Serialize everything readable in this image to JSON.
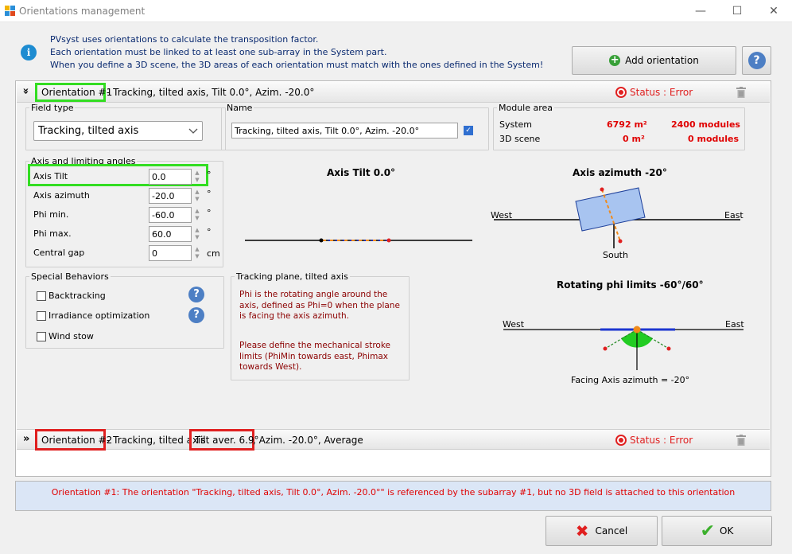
{
  "window": {
    "title": "Orientations management",
    "minimize": "—",
    "maximize": "☐",
    "close": "✕"
  },
  "info": {
    "icon": "info-icon",
    "lines": [
      "PVsyst uses orientations to calculate the transposition factor.",
      "Each orientation must be linked to at least one sub-array in the System part.",
      "When you define a 3D scene, the 3D areas of each orientation must match with the ones defined in the System!"
    ]
  },
  "toolbar": {
    "add_orientation": "Add orientation",
    "help": "?"
  },
  "orientation1": {
    "expander": "»",
    "name": "Orientation #1",
    "summary": "- Tracking, tilted axis, Tilt 0.0°, Azim. -20.0°",
    "status": "Status : Error"
  },
  "field_type": {
    "legend": "Field type",
    "value": "Tracking, tilted axis"
  },
  "name_group": {
    "legend": "Name",
    "value": "Tracking, tilted axis, Tilt 0.0°, Azim. -20.0°"
  },
  "module_area": {
    "legend": "Module area",
    "rows": [
      {
        "label": "System",
        "area": "6792 m²",
        "modules": "2400 modules"
      },
      {
        "label": "3D scene",
        "area": "0 m²",
        "modules": "0 modules"
      }
    ]
  },
  "axis_group": {
    "legend": "Axis and limiting angles",
    "fields": [
      {
        "label": "Axis Tilt",
        "value": "0.0",
        "unit": "°"
      },
      {
        "label": "Axis azimuth",
        "value": "-20.0",
        "unit": "°"
      },
      {
        "label": "Phi min.",
        "value": "-60.0",
        "unit": "°"
      },
      {
        "label": "Phi max.",
        "value": "60.0",
        "unit": "°"
      },
      {
        "label": "Central gap",
        "value": "0",
        "unit": "cm"
      }
    ]
  },
  "special": {
    "legend": "Special Behaviors",
    "backtracking": "Backtracking",
    "irradiance": "Irradiance optimization",
    "wind_stow": "Wind stow"
  },
  "tracking_info": {
    "legend": "Tracking plane, tilted axis",
    "para1": "Phi is the rotating angle around the axis, defined as Phi=0 when the plane is facing the axis azimuth.",
    "para2": "Please define the mechanical stroke limits (PhiMin towards east, Phimax towards West)."
  },
  "diagrams": {
    "axis_tilt_title": "Axis Tilt 0.0°",
    "axis_azimuth_title": "Axis azimuth -20°",
    "west": "West",
    "east": "East",
    "south": "South",
    "phi_title": "Rotating phi limits -60°/60°",
    "facing": "Facing Axis azimuth = -20°"
  },
  "orientation2": {
    "expander": "»",
    "name": "Orientation #2",
    "summary_a": "- Tracking, tilted axis",
    "tilt": "Tilt aver. 6.9°",
    "summary_b": ", Azim. -20.0°, Average",
    "status": "Status : Error"
  },
  "message": "Orientation #1: The orientation \"Tracking, tilted axis, Tilt 0.0°, Azim. -20.0°\" is referenced by the subarray #1, but no 3D field is attached to this orientation",
  "buttons": {
    "cancel": "Cancel",
    "ok": "OK"
  },
  "colors": {
    "accent_blue": "#1e8cd1",
    "error_red": "#e02020",
    "highlight_green": "#33dd22"
  }
}
